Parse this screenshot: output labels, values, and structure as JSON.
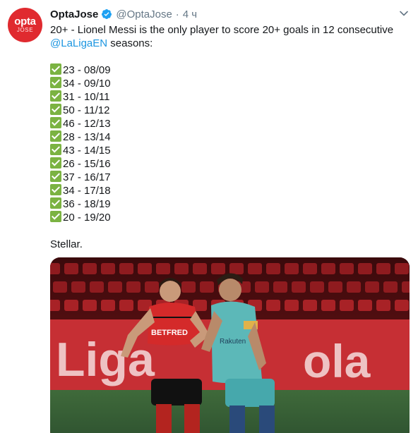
{
  "tweet": {
    "author_name": "OptaJose",
    "author_handle": "@OptaJose",
    "separator": "·",
    "time": "4 ч",
    "avatar": {
      "logo_main": "opta",
      "logo_sub": "JOSE",
      "color": "#e02a2f"
    },
    "text_intro": "20+ - Lionel Messi is the only player to score 20+ goals in 12 consecutive",
    "mention": "@LaLigaEN",
    "text_intro_tail": " seasons:",
    "seasons": [
      "23 - 08/09",
      "34 - 09/10",
      "31 - 10/11",
      "50 - 11/12",
      "46 - 12/13",
      "28 - 13/14",
      "43 - 14/15",
      "26 - 15/16",
      "37 - 16/17",
      "34 - 17/18",
      "36 - 18/19",
      "20 - 19/20"
    ],
    "closing": "Stellar.",
    "media": {
      "board_text_left": "Liga",
      "board_text_right": "ola",
      "sponsor": "BETFRED",
      "shirt_brand": "Rakuten"
    }
  },
  "colors": {
    "link": "#1b95e0",
    "secondary_text": "#657786",
    "verified": "#1da1f2",
    "checkmark": "#7bb342",
    "board_red": "#c62f34"
  },
  "icons": {
    "verified": "verified-badge-icon",
    "caret": "chevron-down-icon",
    "check": "check-mark-button-icon"
  }
}
